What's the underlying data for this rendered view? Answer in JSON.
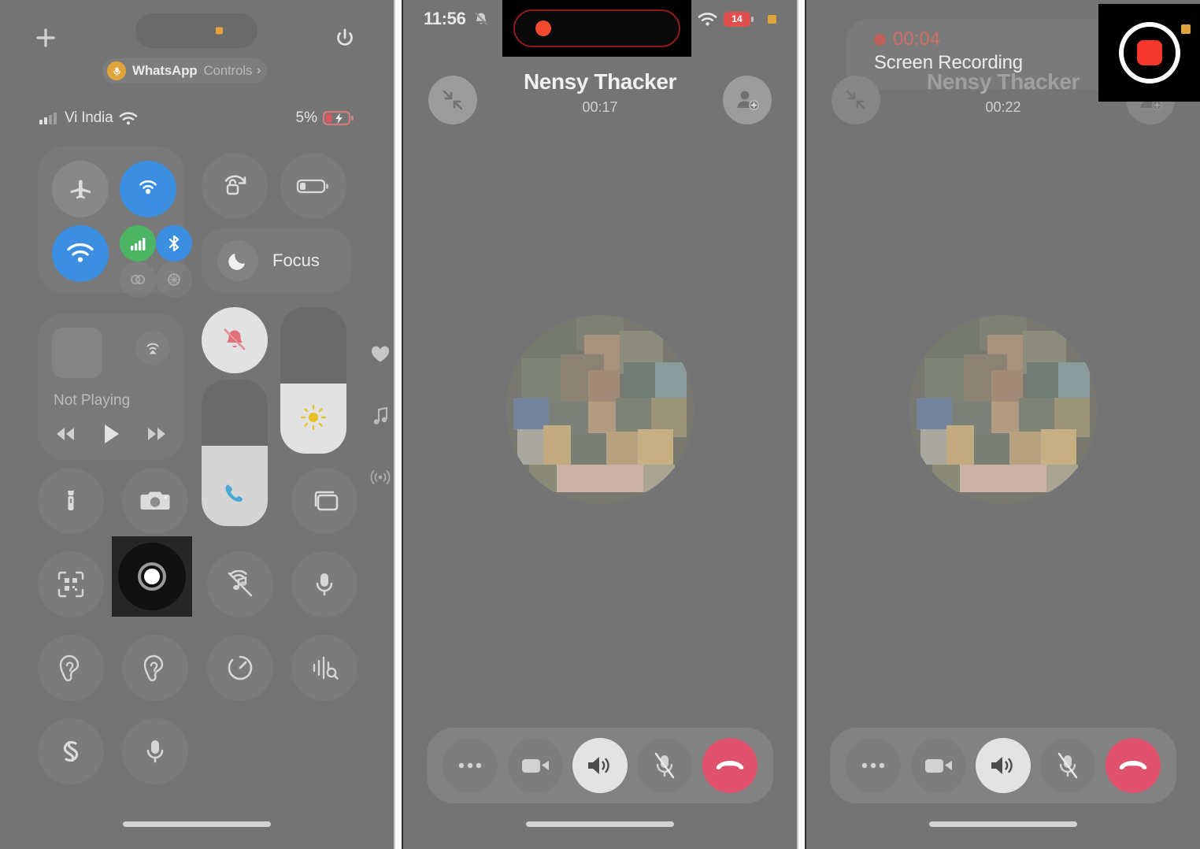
{
  "panels": [
    {
      "id": "control-center",
      "topbar": {
        "add_icon": "plus-icon",
        "power_icon": "power-icon",
        "island_indicator": "orange-mic-dot"
      },
      "app_pill": {
        "app": "WhatsApp",
        "label": "Controls",
        "chevron": "›",
        "mic_icon": "microphone-icon"
      },
      "status": {
        "carrier": "Vi India",
        "wifi_icon": "wifi-icon",
        "signal_icon": "cellular-signal-icon",
        "battery_percent": "5%",
        "battery_icon": "battery-charging-icon"
      },
      "connectivity": {
        "airplane": "Airplane Mode",
        "airdrop": "AirDrop",
        "hotspot": "Personal Hotspot",
        "cellular": "Cellular Data",
        "wifi": "Wi-Fi",
        "bluetooth": "Bluetooth",
        "antenna": "Cellular"
      },
      "rotation_lock": "Rotation Lock",
      "low_power": "Low Power Mode",
      "focus": {
        "label": "Focus",
        "icon": "moon-icon"
      },
      "media": {
        "now_playing": "Not Playing",
        "airplay_icon": "airplay-icon",
        "prev_icon": "rewind-icon",
        "play_icon": "play-icon",
        "next_icon": "fastforward-icon"
      },
      "silent": {
        "icon": "bell-slash-icon",
        "state": "on"
      },
      "volume": {
        "icon": "phone-call-icon",
        "level": 55
      },
      "brightness": {
        "icon": "sun-icon",
        "level": 48
      },
      "side_icons": [
        "heart-icon",
        "music-note-icon",
        "broadcast-icon"
      ],
      "buttons": [
        {
          "name": "flashlight",
          "icon": "flashlight-icon"
        },
        {
          "name": "camera",
          "icon": "camera-icon"
        },
        {
          "name": "screen-mirroring",
          "icon": "screen-mirroring-icon"
        },
        {
          "name": "code-scanner",
          "icon": "qr-scanner-icon"
        },
        {
          "name": "screen-recording",
          "icon": "record-icon",
          "highlighted": true
        },
        {
          "name": "dark-noise",
          "icon": "music-recognition-off-icon"
        },
        {
          "name": "voice-memo",
          "icon": "microphone-icon"
        },
        {
          "name": "hearing",
          "icon": "ear-icon"
        },
        {
          "name": "hearing-aids",
          "icon": "ear-icon"
        },
        {
          "name": "timer",
          "icon": "timer-icon"
        },
        {
          "name": "sound-recognition",
          "icon": "sound-recognition-icon"
        },
        {
          "name": "shazam",
          "icon": "shazam-icon"
        },
        {
          "name": "voice-control",
          "icon": "microphone-icon"
        }
      ],
      "home_indicator": "home-indicator"
    },
    {
      "id": "call-recording-start",
      "status": {
        "time": "11:56",
        "bell_icon": "bell-slash-icon",
        "signal_icon": "cellular-signal-icon",
        "wifi_icon": "wifi-icon",
        "battery_percent": "14",
        "mic_indicator": "orange-mic-square"
      },
      "dynamic_island": {
        "highlighted": true,
        "recording_dot": "red-record-dot"
      },
      "call": {
        "name": "Nensy Thacker",
        "duration": "00:17",
        "minimize_icon": "minimize-icon",
        "add_person_icon": "add-person-icon",
        "avatar": "contact-photo-blurred"
      },
      "controls": [
        {
          "name": "more",
          "icon": "ellipsis-icon",
          "active": false
        },
        {
          "name": "video",
          "icon": "video-camera-icon",
          "active": false
        },
        {
          "name": "speaker",
          "icon": "speaker-icon",
          "active": true
        },
        {
          "name": "mute",
          "icon": "microphone-slash-icon",
          "active": false
        },
        {
          "name": "end-call",
          "icon": "end-call-icon",
          "active": false
        }
      ],
      "home_indicator": "home-indicator"
    },
    {
      "id": "call-recording-stop",
      "banner": {
        "timer": "00:04",
        "title": "Screen Recording",
        "dot": "red-record-dot"
      },
      "stop_button": {
        "highlighted": true,
        "icon": "stop-record-icon",
        "mic_indicator": "orange-mic-square"
      },
      "call": {
        "name": "Nensy Thacker",
        "duration": "00:22",
        "minimize_icon": "minimize-icon",
        "add_person_icon": "add-person-icon",
        "avatar": "contact-photo-blurred"
      },
      "controls": [
        {
          "name": "more",
          "icon": "ellipsis-icon",
          "active": false
        },
        {
          "name": "video",
          "icon": "video-camera-icon",
          "active": false
        },
        {
          "name": "speaker",
          "icon": "speaker-icon",
          "active": true
        },
        {
          "name": "mute",
          "icon": "microphone-slash-icon",
          "active": false
        },
        {
          "name": "end-call",
          "icon": "end-call-icon",
          "active": false
        }
      ],
      "home_indicator": "home-indicator"
    }
  ],
  "colors": {
    "panel_bg": "#747474",
    "accent_blue": "#3c8ee0",
    "accent_green": "#4cb563",
    "record_red": "#f04a30",
    "end_call": "#e0516e",
    "mic_orange": "#e0a53a",
    "battery_red": "#e0504e"
  }
}
